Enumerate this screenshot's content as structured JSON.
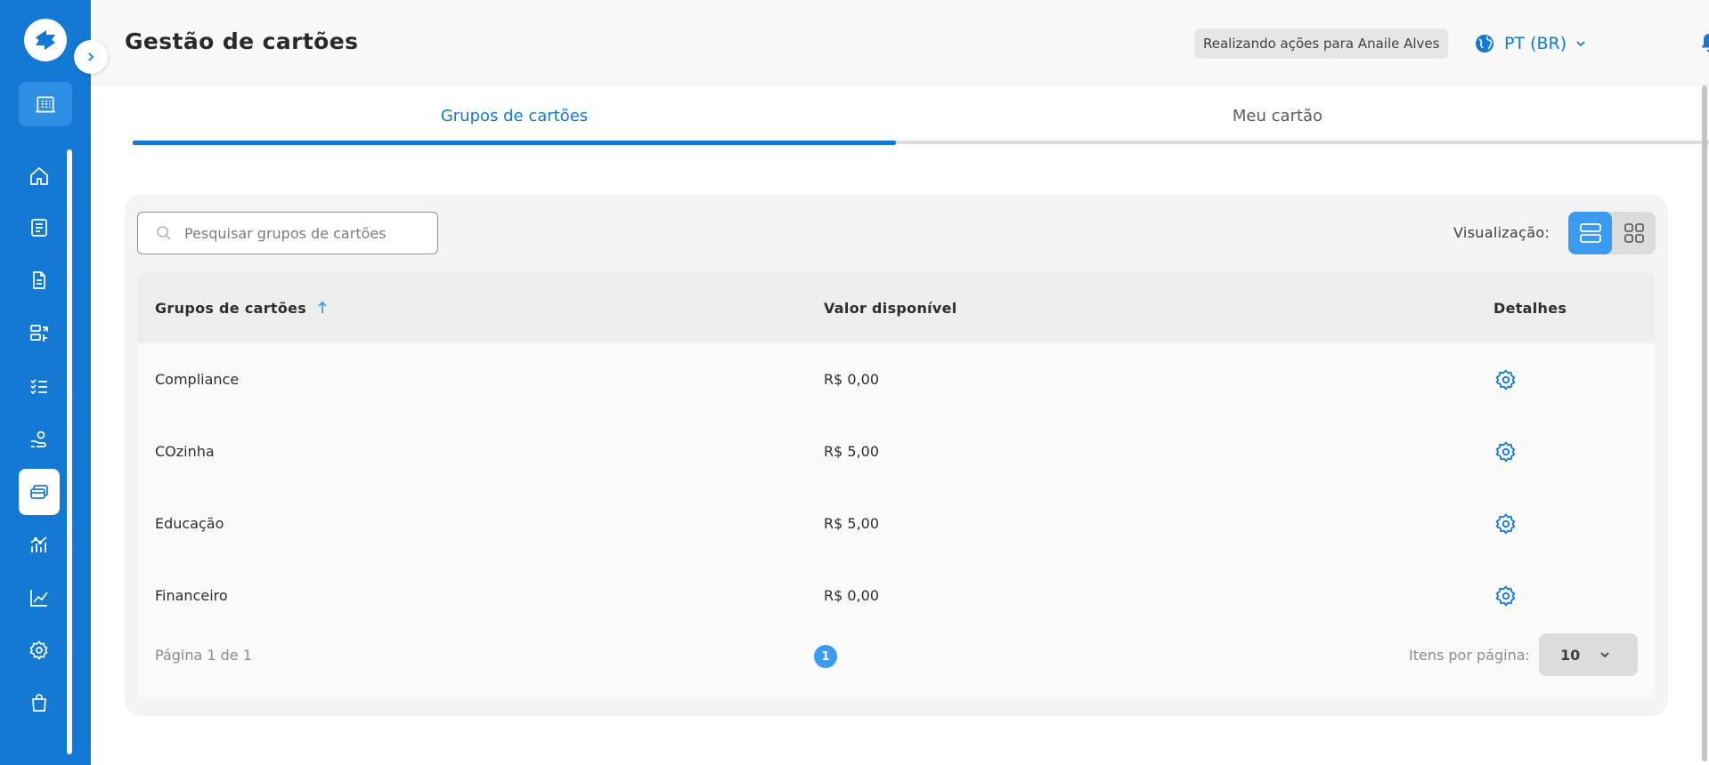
{
  "header": {
    "title": "Gestão de cartões",
    "acting_as": "Realizando ações para Anaile Alves",
    "language": "PT (BR)"
  },
  "sidebar": {
    "items": [
      {
        "name": "home",
        "icon": "home-icon"
      },
      {
        "name": "statements",
        "icon": "list-document-icon"
      },
      {
        "name": "documents",
        "icon": "document-icon"
      },
      {
        "name": "transfers",
        "icon": "transfer-icon"
      },
      {
        "name": "tasks",
        "icon": "checklist-icon"
      },
      {
        "name": "benefits",
        "icon": "hand-coin-icon"
      },
      {
        "name": "cards",
        "icon": "cards-icon",
        "active": true
      },
      {
        "name": "analytics",
        "icon": "analytics-icon"
      },
      {
        "name": "reports",
        "icon": "line-chart-icon"
      },
      {
        "name": "settings",
        "icon": "gear-icon"
      },
      {
        "name": "store",
        "icon": "shopping-bag-icon"
      }
    ]
  },
  "tabs": [
    {
      "label": "Grupos de cartões",
      "active": true
    },
    {
      "label": "Meu cartão",
      "active": false
    }
  ],
  "search": {
    "placeholder": "Pesquisar grupos de cartões",
    "value": ""
  },
  "view": {
    "label": "Visualização:",
    "mode": "list"
  },
  "table": {
    "columns": [
      "Grupos de cartões",
      "Valor disponível",
      "Detalhes"
    ],
    "sort": {
      "column": "Grupos de cartões",
      "direction": "ascending"
    },
    "rows": [
      {
        "group": "Compliance",
        "value": "R$ 0,00"
      },
      {
        "group": "COzinha",
        "value": "R$ 5,00"
      },
      {
        "group": "Educação",
        "value": "R$ 5,00"
      },
      {
        "group": "Financeiro",
        "value": "R$ 0,00"
      }
    ]
  },
  "pagination": {
    "info": "Página 1 de 1",
    "current": "1",
    "per_page_label": "Itens por página:",
    "per_page": "10"
  },
  "colors": {
    "brand": "#1479d5",
    "accent": "#3b9bf0",
    "card_bg": "#f4f4f4"
  }
}
